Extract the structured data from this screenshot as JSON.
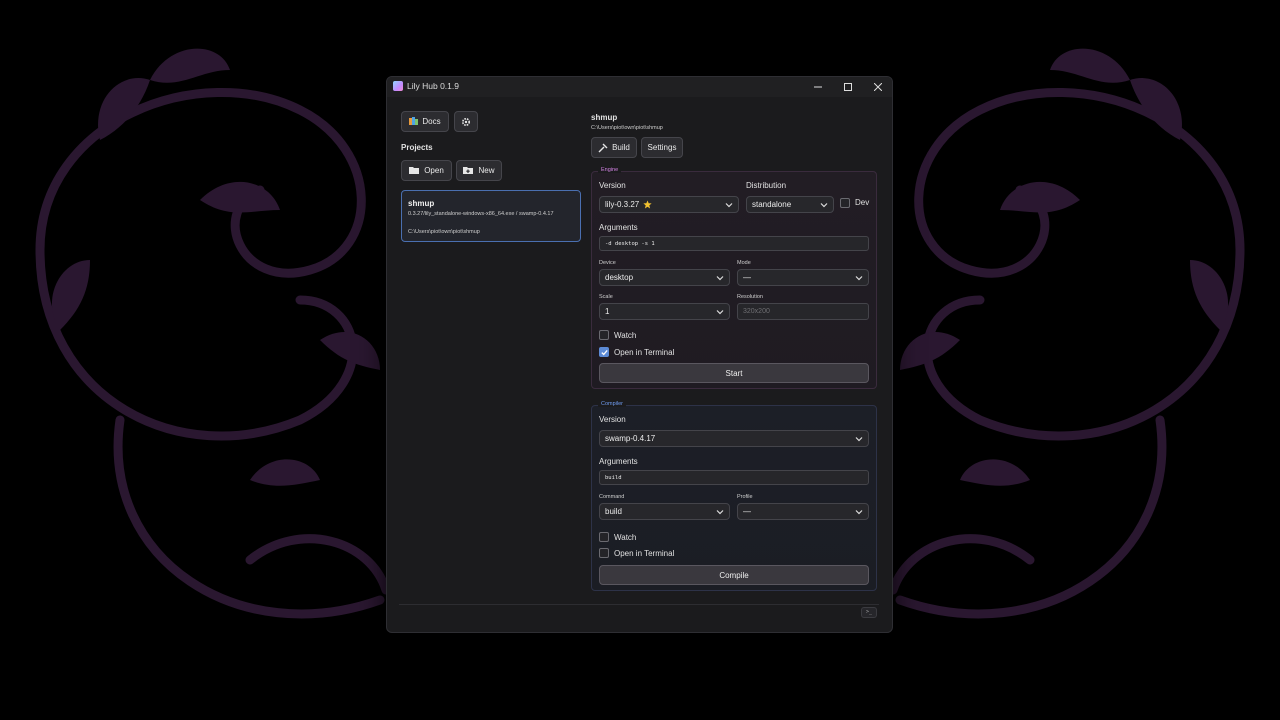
{
  "window": {
    "title": "Lily Hub 0.1.9"
  },
  "sidebar": {
    "docs_label": "Docs",
    "projects_heading": "Projects",
    "open_label": "Open",
    "new_label": "New",
    "project": {
      "name": "shmup",
      "meta": "0.3.27/lily_standalone-windows-x86_64.exe / swamp-0.4.17",
      "path": "C:\\Users\\piot\\own\\piot\\shmup"
    }
  },
  "main": {
    "project_name": "shmup",
    "project_path": "C:\\Users\\piot\\own\\piot\\shmup",
    "tabs": {
      "build": "Build",
      "settings": "Settings"
    },
    "engine": {
      "tag": "Engine",
      "version_label": "Version",
      "version_value": "lily-0.3.27",
      "distribution_label": "Distribution",
      "distribution_value": "standalone",
      "dev_label": "Dev",
      "arguments_label": "Arguments",
      "arguments_value": "-d desktop -s 1",
      "device_label": "Device",
      "device_value": "desktop",
      "mode_label": "Mode",
      "mode_value": "—",
      "scale_label": "Scale",
      "scale_value": "1",
      "resolution_label": "Resolution",
      "resolution_placeholder": "320x200",
      "watch_label": "Watch",
      "watch_checked": false,
      "terminal_label": "Open in Terminal",
      "terminal_checked": true,
      "start_label": "Start"
    },
    "compiler": {
      "tag": "Compiler",
      "version_label": "Version",
      "version_value": "swamp-0.4.17",
      "arguments_label": "Arguments",
      "arguments_value": "build",
      "command_label": "Command",
      "command_value": "build",
      "profile_label": "Profile",
      "profile_value": "—",
      "watch_label": "Watch",
      "watch_checked": false,
      "terminal_label": "Open in Terminal",
      "terminal_checked": false,
      "compile_label": "Compile"
    }
  },
  "footer": {
    "terminal_icon": ">_"
  },
  "colors": {
    "accent": "#5d8bd6",
    "engine": "#d583e6",
    "compiler": "#6f9cf2",
    "ornament": "#2a1730"
  }
}
